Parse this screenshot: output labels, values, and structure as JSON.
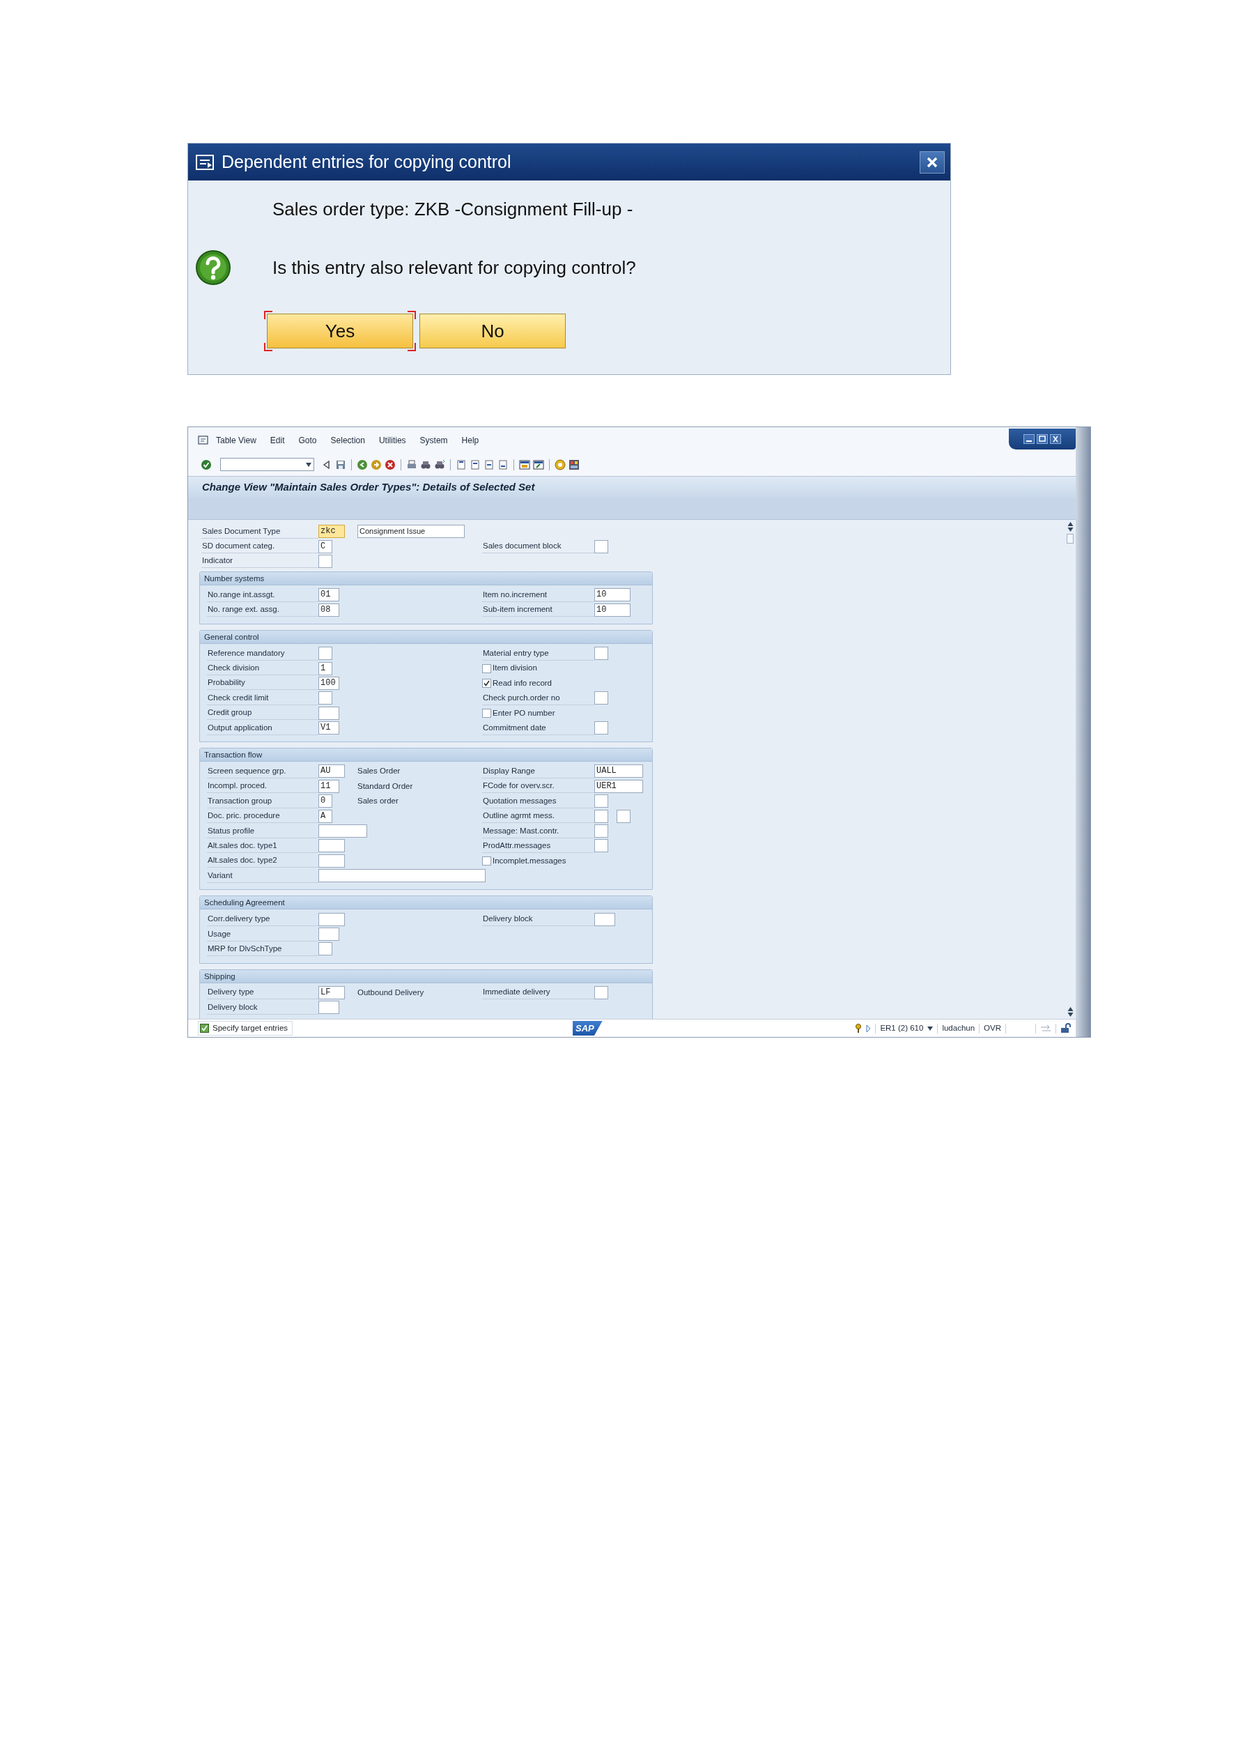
{
  "dialog": {
    "title": "Dependent entries for copying control",
    "message": "Sales order type: ZKB -Consignment Fill-up -",
    "question": "Is this entry also relevant for copying control?",
    "buttons": [
      {
        "label": "Yes",
        "focused": true
      },
      {
        "label": "No",
        "focused": false
      }
    ]
  },
  "window": {
    "menu": [
      "Table View",
      "Edit",
      "Goto",
      "Selection",
      "Utilities",
      "System",
      "Help"
    ],
    "title": "Change View \"Maintain Sales Order Types\": Details of Selected Set",
    "header_rows": [
      {
        "left": {
          "kind": "key",
          "label": "Sales Document Type",
          "value": "zkc",
          "highlighted": true,
          "desc_field": "Consignment Issue"
        },
        "right": null
      },
      {
        "left": {
          "kind": "flag",
          "label": "SD document categ.",
          "value": "C"
        },
        "right": {
          "kind": "flag",
          "label": "Sales document block"
        }
      },
      {
        "left": {
          "kind": "flag",
          "label": "Indicator"
        },
        "right": null
      }
    ],
    "groups": [
      {
        "title": "Number systems",
        "rows": [
          {
            "left": {
              "kind": "code",
              "label": "No.range int.assgt.",
              "value": "01"
            },
            "right": {
              "kind": "medium",
              "label": "Item no.increment",
              "value": "10"
            }
          },
          {
            "left": {
              "kind": "code",
              "label": "No. range ext. assg.",
              "value": "08"
            },
            "right": {
              "kind": "medium",
              "label": "Sub-item increment",
              "value": "10"
            }
          }
        ]
      },
      {
        "title": "General control",
        "rows": [
          {
            "left": {
              "kind": "flag",
              "label": "Reference mandatory"
            },
            "right": {
              "kind": "flag",
              "label": "Material entry type"
            }
          },
          {
            "left": {
              "kind": "flag",
              "label": "Check division",
              "value": "1"
            },
            "right": {
              "kind": "check",
              "label": "Item division",
              "checked": false
            }
          },
          {
            "left": {
              "kind": "code",
              "label": "Probability",
              "value": "100"
            },
            "right": {
              "kind": "check",
              "label": "Read info record",
              "checked": true
            }
          },
          {
            "left": {
              "kind": "flag",
              "label": "Check credit limit"
            },
            "right": {
              "kind": "flag",
              "label": "Check purch.order no"
            }
          },
          {
            "left": {
              "kind": "code",
              "label": "Credit group"
            },
            "right": {
              "kind": "check",
              "label": "Enter PO number",
              "checked": false
            }
          },
          {
            "left": {
              "kind": "code",
              "label": "Output application",
              "value": "V1"
            },
            "right": {
              "kind": "flag",
              "label": "Commitment date"
            }
          }
        ]
      },
      {
        "title": "Transaction flow",
        "rows": [
          {
            "left": {
              "kind": "key",
              "label": "Screen sequence grp.",
              "value": "AU",
              "desc": "Sales Order"
            },
            "right": {
              "kind": "long",
              "label": "Display Range",
              "value": "UALL"
            }
          },
          {
            "left": {
              "kind": "code",
              "label": "Incompl. proced.",
              "value": "11",
              "desc": "Standard Order"
            },
            "right": {
              "kind": "long",
              "label": "FCode for overv.scr.",
              "value": "UER1"
            }
          },
          {
            "left": {
              "kind": "flag",
              "label": "Transaction group",
              "value": "0",
              "desc": "Sales order"
            },
            "right": {
              "kind": "flag",
              "label": "Quotation messages"
            }
          },
          {
            "left": {
              "kind": "flag",
              "label": "Doc. pric. procedure",
              "value": "A"
            },
            "right": {
              "kind": "flag",
              "label": "Outline agrmt mess.",
              "extra_box": true
            }
          },
          {
            "left": {
              "kind": "long",
              "label": "Status profile"
            },
            "right": {
              "kind": "flag",
              "label": "Message: Mast.contr."
            }
          },
          {
            "left": {
              "kind": "key",
              "label": "Alt.sales doc. type1"
            },
            "right": {
              "kind": "flag",
              "label": "ProdAttr.messages"
            }
          },
          {
            "left": {
              "kind": "key",
              "label": "Alt.sales doc. type2"
            },
            "right": {
              "kind": "check",
              "label": "Incomplet.messages",
              "checked": false
            }
          },
          {
            "left": {
              "kind": "wide",
              "label": "Variant"
            },
            "right": null
          }
        ]
      },
      {
        "title": "Scheduling Agreement",
        "rows": [
          {
            "left": {
              "kind": "key",
              "label": "Corr.delivery type"
            },
            "right": {
              "kind": "code",
              "label": "Delivery block"
            }
          },
          {
            "left": {
              "kind": "code",
              "label": "Usage"
            },
            "right": null
          },
          {
            "left": {
              "kind": "flag",
              "label": "MRP for DlvSchType"
            },
            "right": null
          }
        ]
      },
      {
        "title": "Shipping",
        "rows": [
          {
            "left": {
              "kind": "key",
              "label": "Delivery type",
              "value": "LF",
              "desc": "Outbound Delivery"
            },
            "right": {
              "kind": "flag",
              "label": "Immediate delivery"
            }
          },
          {
            "left": {
              "kind": "code",
              "label": "Delivery block"
            },
            "right": null
          }
        ]
      }
    ],
    "status_bar": {
      "message": "Specify target entries",
      "logo": "SAP",
      "system": "ER1 (2) 610",
      "user": "ludachun",
      "mode": "OVR"
    }
  }
}
